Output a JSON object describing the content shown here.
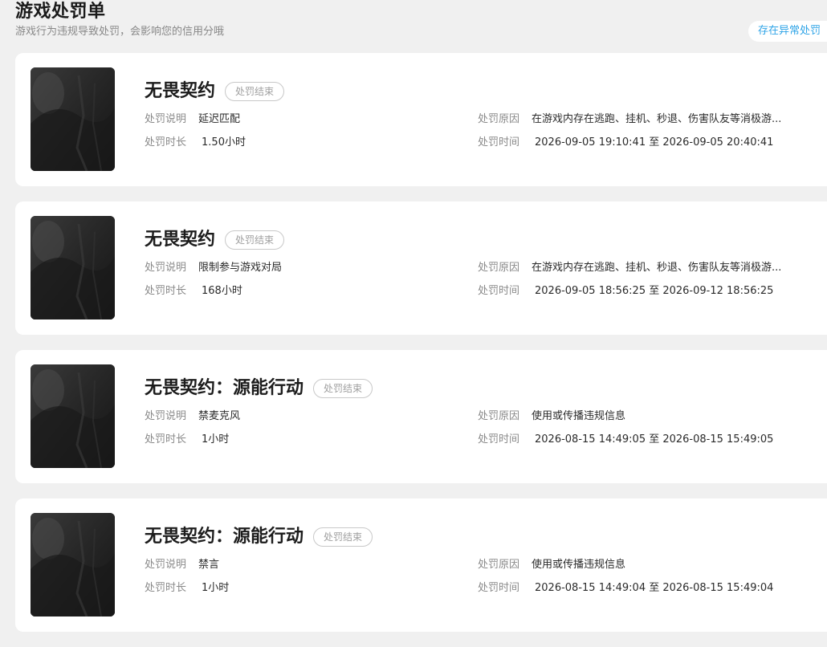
{
  "header": {
    "title": "游戏处罚单",
    "subtitle": "游戏行为违规导致处罚，会影响您的信用分哦",
    "anomaly_button": "存在异常处罚"
  },
  "labels": {
    "description": "处罚说明",
    "reason": "处罚原因",
    "duration": "处罚时长",
    "time": "处罚时间"
  },
  "penalties": [
    {
      "game": "无畏契约",
      "status": "处罚结束",
      "description": "延迟匹配",
      "reason": "在游戏内存在逃跑、挂机、秒退、伤害队友等消极游...",
      "duration": "1.50小时",
      "time": "2026-09-05 19:10:41 至 2026-09-05 20:40:41"
    },
    {
      "game": "无畏契约",
      "status": "处罚结束",
      "description": "限制参与游戏对局",
      "reason": "在游戏内存在逃跑、挂机、秒退、伤害队友等消极游...",
      "duration": "168小时",
      "time": "2026-09-05 18:56:25 至 2026-09-12 18:56:25"
    },
    {
      "game": "无畏契约：源能行动",
      "status": "处罚结束",
      "description": "禁麦克风",
      "reason": "使用或传播违规信息",
      "duration": "1小时",
      "time": "2026-08-15 14:49:05 至 2026-08-15 15:49:05"
    },
    {
      "game": "无畏契约：源能行动",
      "status": "处罚结束",
      "description": "禁言",
      "reason": "使用或传播违规信息",
      "duration": "1小时",
      "time": "2026-08-15 14:49:04 至 2026-08-15 15:49:04"
    }
  ],
  "colors": {
    "background": "#f0f0f0",
    "card": "#ffffff",
    "accent": "#2fa4e7",
    "badge_text": "#a0a0a0"
  }
}
